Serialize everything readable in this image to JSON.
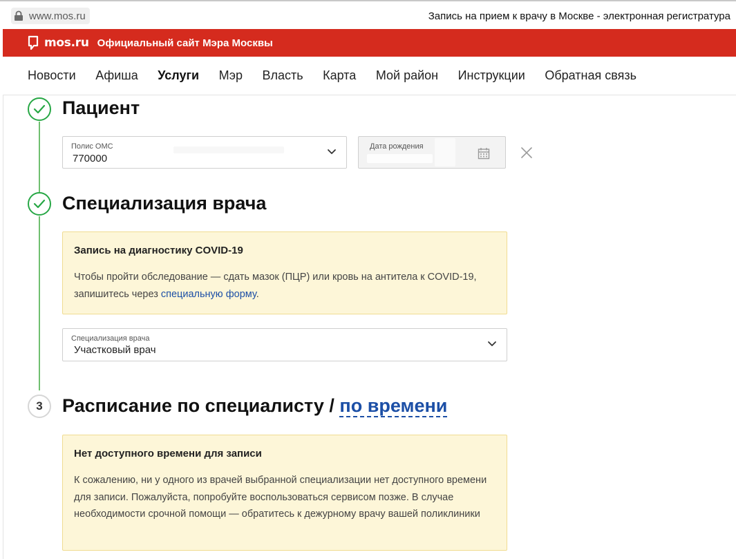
{
  "browser": {
    "url": "www.mos.ru",
    "tab_title": "Запись на прием к врачу в Москве - электронная регистратура"
  },
  "header": {
    "logo_text": "mos.ru",
    "site_name": "Официальный сайт Мэра Москвы",
    "accent_color": "#d52b1e"
  },
  "nav": {
    "items": [
      {
        "label": "Новости"
      },
      {
        "label": "Афиша"
      },
      {
        "label": "Услуги",
        "active": true
      },
      {
        "label": "Мэр"
      },
      {
        "label": "Власть"
      },
      {
        "label": "Карта"
      },
      {
        "label": "Мой район"
      },
      {
        "label": "Инструкции"
      },
      {
        "label": "Обратная связь"
      }
    ]
  },
  "steps": {
    "patient": {
      "title": "Пациент",
      "status": "completed",
      "oms_field": {
        "label": "Полис ОМС",
        "value": "770000"
      },
      "birthdate_field": {
        "label": "Дата рождения",
        "value": ""
      }
    },
    "specialization": {
      "title": "Специализация врача",
      "status": "completed",
      "covid_notice": {
        "title": "Запись на диагностику COVID-19",
        "text": "Чтобы пройти обследование — сдать мазок (ПЦР) или кровь на антитела к COVID-19, запишитесь через",
        "link_text": "специальную форму",
        "after_link": "."
      },
      "select": {
        "label": "Специализация врача",
        "value": "Участковый врач"
      }
    },
    "schedule": {
      "number": "3",
      "title_prefix": "Расписание по специалисту / ",
      "title_link": "по времени",
      "notice": {
        "title": "Нет доступного времени для записи",
        "text": "К сожалению, ни у одного из врачей выбранной специализации нет доступного времени для записи. Пожалуйста, попробуйте воспользоваться сервисом позже. В случае необходимости срочной помощи — обратитесь к дежурному врачу вашей поликлиники"
      }
    }
  },
  "icons": {
    "lock": "lock-icon",
    "logo": "mos-logo-icon",
    "check": "check-icon",
    "chevron": "chevron-down-icon",
    "calendar": "calendar-icon",
    "close": "close-icon"
  }
}
